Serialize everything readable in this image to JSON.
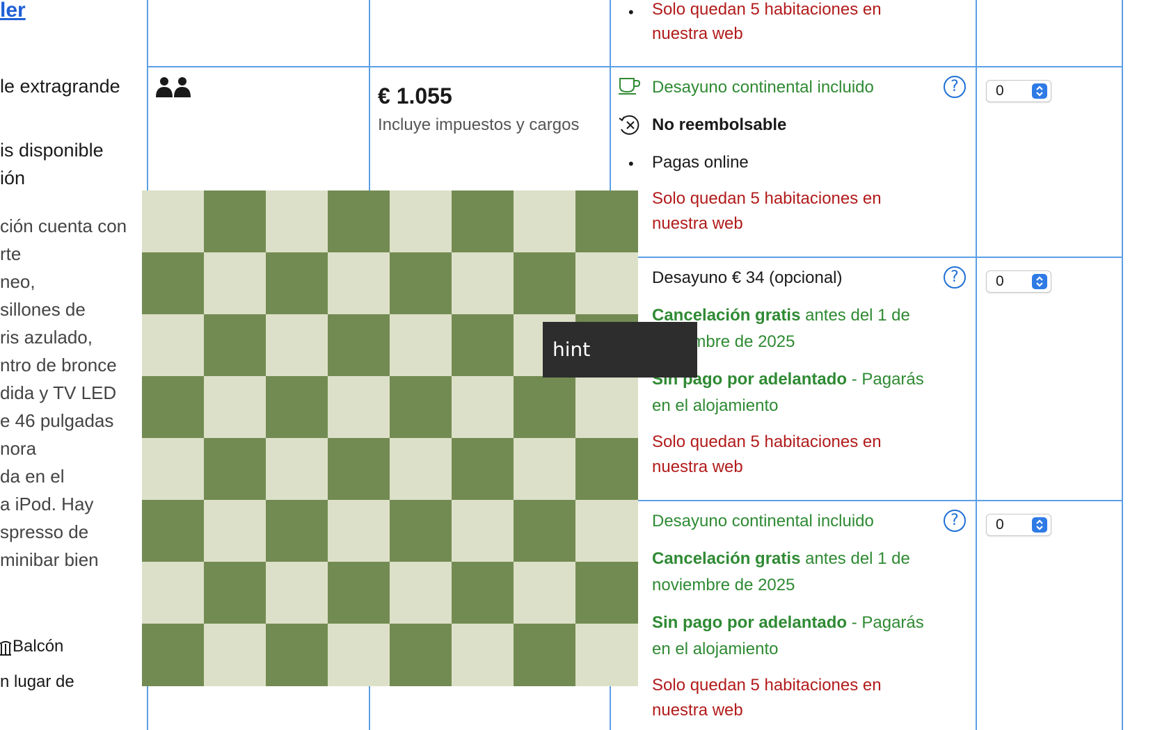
{
  "left_column": {
    "link": "ler",
    "bed": "le extragrande",
    "avail_line1": "is disponible",
    "avail_line2": "ión",
    "description_lines": [
      "ción cuenta con",
      "rte",
      "neo,",
      " sillones de",
      "ris azulado,",
      "ntro de bronce",
      "dida y TV LED",
      "e 46 pulgadas",
      "nora",
      "da en el",
      "a iPod. Hay",
      "spresso de",
      "minibar bien"
    ],
    "balcony": "Balcón",
    "extra": "n lugar de"
  },
  "room_block": {
    "price": "€ 1.055",
    "taxes_note": "Incluye impuestos y cargos"
  },
  "options": [
    {
      "availability_line1": "Solo quedan 5 habitaciones en",
      "availability_line2": "nuestra web"
    },
    {
      "breakfast": "Desayuno continental incluido",
      "policy": "No reembolsable",
      "payment": "Pagas online",
      "availability_line1": "Solo quedan 5 habitaciones en",
      "availability_line2": "nuestra web",
      "quantity": "0"
    },
    {
      "breakfast": "Desayuno € 34 (opcional)",
      "cancel_bold": "Cancelación gratis",
      "cancel_rest": " antes del 1 de",
      "cancel_line2": "noviembre de 2025",
      "prepay_bold": "Sin pago por adelantado",
      "prepay_rest": " - Pagarás",
      "prepay_line2": "en el alojamiento",
      "availability_line1": "Solo quedan 5 habitaciones en",
      "availability_line2": "nuestra web",
      "quantity": "0"
    },
    {
      "breakfast": "Desayuno continental incluido",
      "cancel_bold": "Cancelación gratis",
      "cancel_rest": " antes del 1 de",
      "cancel_line2": "noviembre de 2025",
      "prepay_bold": "Sin pago por adelantado",
      "prepay_rest": " - Pagarás",
      "prepay_line2": "en el alojamiento",
      "availability_line1": "Solo quedan 5 habitaciones en",
      "availability_line2": "nuestra web",
      "quantity": "0"
    }
  ],
  "help_symbol": "?",
  "tooltip": "hint",
  "colors": {
    "grid": "#5a9fe6",
    "green": "#2f8a33",
    "red": "#b21b1b",
    "link": "#1f5fd6",
    "checker_light": "#dde0c8",
    "checker_dark": "#728b52"
  }
}
